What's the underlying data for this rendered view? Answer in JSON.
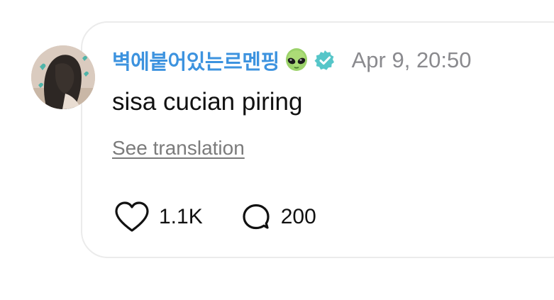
{
  "post": {
    "author": {
      "username": "벽에붙어있는르멘핑",
      "emoji_icon": "alien-emoji",
      "verified_icon": "verified-badge-icon",
      "avatar": "avatar"
    },
    "timestamp": "Apr 9, 20:50",
    "text": "sisa cucian piring",
    "translate_label": "See translation",
    "likes": {
      "icon": "heart-icon",
      "count": "1.1K"
    },
    "comments": {
      "icon": "comment-bubble-icon",
      "count": "200"
    }
  },
  "colors": {
    "username": "#3d93df",
    "verified_badge": "#56c6c9",
    "timestamp": "#8a8a8e",
    "card_border": "#ebebeb",
    "translate_text": "#7b7b7b"
  }
}
